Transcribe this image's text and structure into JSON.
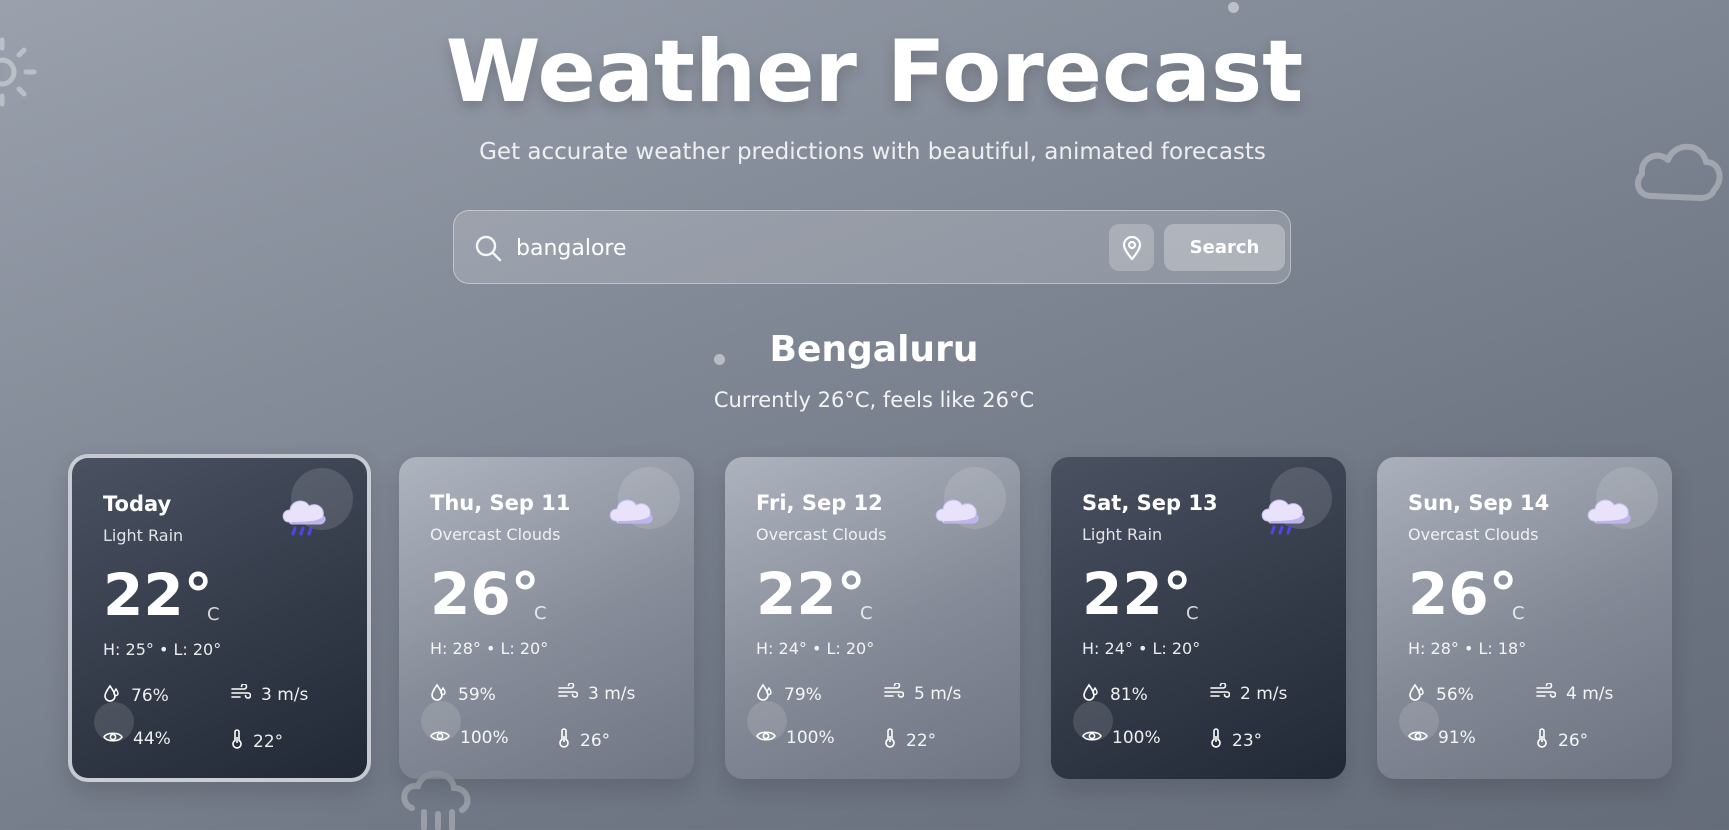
{
  "header": {
    "title": "Weather Forecast",
    "subtitle": "Get accurate weather predictions with beautiful, animated forecasts"
  },
  "search": {
    "value": "bangalore",
    "button_label": "Search"
  },
  "location": {
    "city": "Bengaluru",
    "current": "Currently 26°C, feels like 26°C"
  },
  "forecast": [
    {
      "day": "Today",
      "condition": "Light Rain",
      "icon": "rain-cloud-icon",
      "temp": "22°",
      "unit": "C",
      "hilo": "H: 25°  •  L: 20°",
      "humidity": "76%",
      "wind": "3 m/s",
      "visibility": "44%",
      "feels_like": "22°",
      "selected": true
    },
    {
      "day": "Thu, Sep 11",
      "condition": "Overcast Clouds",
      "icon": "cloud-icon",
      "temp": "26°",
      "unit": "C",
      "hilo": "H: 28°  •  L: 20°",
      "humidity": "59%",
      "wind": "3 m/s",
      "visibility": "100%",
      "feels_like": "26°",
      "selected": false
    },
    {
      "day": "Fri, Sep 12",
      "condition": "Overcast Clouds",
      "icon": "cloud-icon",
      "temp": "22°",
      "unit": "C",
      "hilo": "H: 24°  •  L: 20°",
      "humidity": "79%",
      "wind": "5 m/s",
      "visibility": "100%",
      "feels_like": "22°",
      "selected": false
    },
    {
      "day": "Sat, Sep 13",
      "condition": "Light Rain",
      "icon": "rain-cloud-icon",
      "temp": "22°",
      "unit": "C",
      "hilo": "H: 24°  •  L: 20°",
      "humidity": "81%",
      "wind": "2 m/s",
      "visibility": "100%",
      "feels_like": "23°",
      "selected": false
    },
    {
      "day": "Sun, Sep 14",
      "condition": "Overcast Clouds",
      "icon": "cloud-icon",
      "temp": "26°",
      "unit": "C",
      "hilo": "H: 28°  •  L: 18°",
      "humidity": "56%",
      "wind": "4 m/s",
      "visibility": "91%",
      "feels_like": "26°",
      "selected": false
    }
  ],
  "colors": {
    "rain_drop": "#4f46e5",
    "cloud": "#d6cff5",
    "card_dark": "#2a3140"
  }
}
